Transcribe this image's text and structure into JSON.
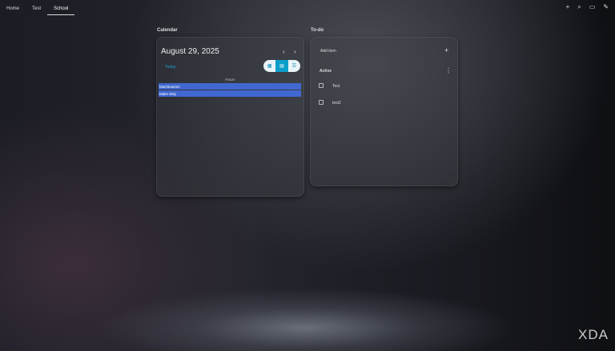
{
  "nav": {
    "tabs": [
      "Home",
      "Test",
      "School"
    ],
    "active": "School"
  },
  "toolbar": {
    "add": "+",
    "search": "⌕",
    "feedback": "▭",
    "edit": "✎"
  },
  "calendar": {
    "title": "Calendar",
    "date": "August 29, 2025",
    "today": "Today",
    "day": "FRIDAY",
    "events": [
      "Machinarium",
      "Make Way"
    ]
  },
  "todo": {
    "title": "To-do",
    "add_item": "Add item",
    "add_icon": "+",
    "section": "Active",
    "items": [
      "Test",
      "test2"
    ]
  },
  "watermark": "XDA"
}
